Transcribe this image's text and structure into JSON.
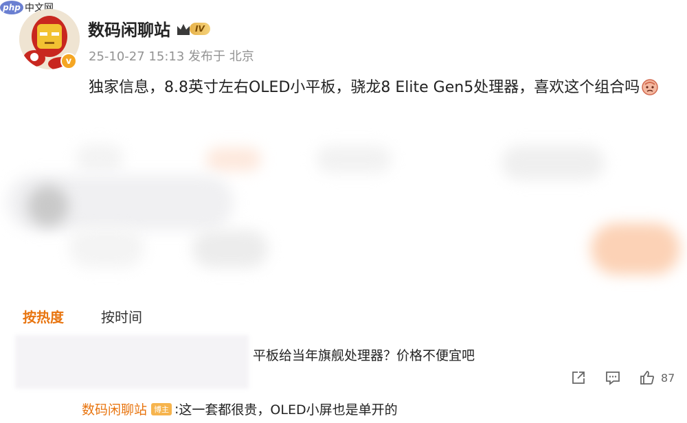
{
  "watermark": {
    "logo": "php",
    "text": "中文网"
  },
  "post": {
    "author": "数码闲聊站",
    "level": "IV",
    "verified_mark": "v",
    "date": "25-10-27 15:13",
    "published_label": "发布于",
    "location": "北京",
    "text": "独家信息，8.8英寸左右OLED小平板，骁龙8 Elite Gen5处理器，喜欢这个组合吗",
    "emoji": "thinking-face-emoji"
  },
  "sort": {
    "hot": "按热度",
    "time": "按时间"
  },
  "comment": {
    "text": "平板给当年旗舰处理器？价格不便宜吧",
    "like_count": "87",
    "icons": [
      "share-icon",
      "comment-icon",
      "like-icon"
    ]
  },
  "reply": {
    "name": "数码闲聊站",
    "badge": "博主",
    "text": "这一套都很贵，OLED小屏也是单开的"
  },
  "colors": {
    "accent_orange": "#e87510",
    "meta_gray": "#939393",
    "badge_gold": "#e7b24a"
  }
}
